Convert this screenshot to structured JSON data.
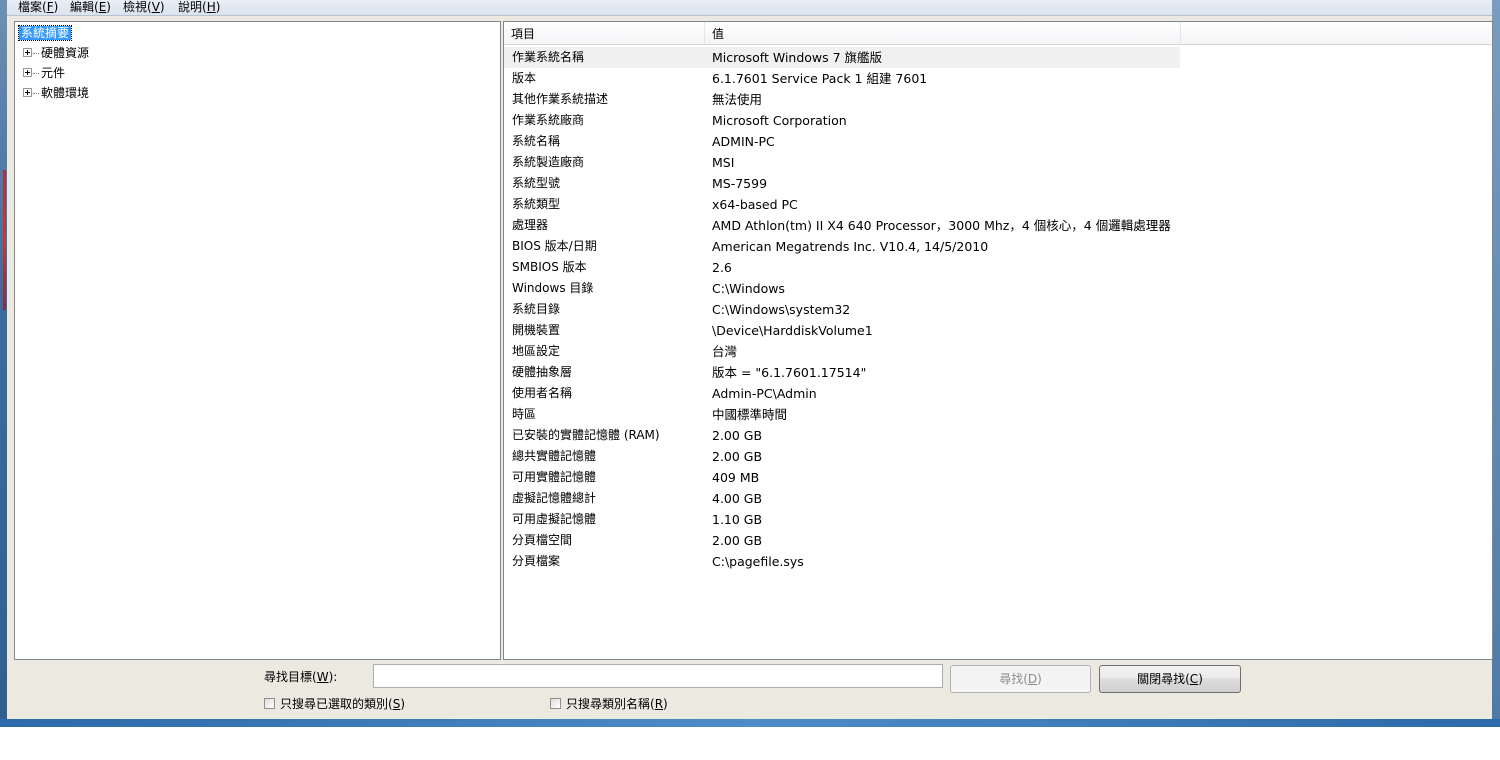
{
  "menu": [
    {
      "label": "檔案(",
      "key": "F",
      "end": ")"
    },
    {
      "label": "編輯(",
      "key": "E",
      "end": ")"
    },
    {
      "label": "檢視(",
      "key": "V",
      "end": ")"
    },
    {
      "label": "說明(",
      "key": "H",
      "end": ")"
    }
  ],
  "tree": {
    "root": "系統摘要",
    "children": [
      "硬體資源",
      "元件",
      "軟體環境"
    ]
  },
  "table": {
    "columns": [
      "項目",
      "值"
    ],
    "rows": [
      {
        "item": "作業系統名稱",
        "value": "Microsoft Windows 7 旗艦版"
      },
      {
        "item": "版本",
        "value": "6.1.7601 Service Pack 1 組建 7601"
      },
      {
        "item": "其他作業系統描述",
        "value": "無法使用"
      },
      {
        "item": "作業系統廠商",
        "value": "Microsoft Corporation"
      },
      {
        "item": "系統名稱",
        "value": "ADMIN-PC"
      },
      {
        "item": "系統製造廠商",
        "value": "MSI"
      },
      {
        "item": "系統型號",
        "value": "MS-7599"
      },
      {
        "item": "系統類型",
        "value": "x64-based PC"
      },
      {
        "item": "處理器",
        "value": "AMD Athlon(tm) II X4 640 Processor，3000 Mhz，4 個核心，4 個邏輯處理器"
      },
      {
        "item": "BIOS 版本/日期",
        "value": "American Megatrends Inc. V10.4, 14/5/2010"
      },
      {
        "item": "SMBIOS 版本",
        "value": "2.6"
      },
      {
        "item": "Windows 目錄",
        "value": "C:\\Windows"
      },
      {
        "item": "系統目錄",
        "value": "C:\\Windows\\system32"
      },
      {
        "item": "開機裝置",
        "value": "\\Device\\HarddiskVolume1"
      },
      {
        "item": "地區設定",
        "value": "台灣"
      },
      {
        "item": "硬體抽象層",
        "value": "版本 = \"6.1.7601.17514\""
      },
      {
        "item": "使用者名稱",
        "value": "Admin-PC\\Admin"
      },
      {
        "item": "時區",
        "value": "中國標準時間"
      },
      {
        "item": "已安裝的實體記憶體 (RAM)",
        "value": "2.00 GB"
      },
      {
        "item": "總共實體記憶體",
        "value": "2.00 GB"
      },
      {
        "item": "可用實體記憶體",
        "value": "409 MB"
      },
      {
        "item": "虛擬記憶體總計",
        "value": "4.00 GB"
      },
      {
        "item": "可用虛擬記憶體",
        "value": "1.10 GB"
      },
      {
        "item": "分頁檔空間",
        "value": "2.00 GB"
      },
      {
        "item": "分頁檔案",
        "value": "C:\\pagefile.sys"
      }
    ]
  },
  "find": {
    "label": "尋找目標(",
    "label_key": "W",
    "label_end": "):",
    "input_value": "",
    "find_button": "尋找(",
    "find_key": "D",
    "close_button": "關閉尋找(",
    "close_key": "C",
    "btn_end": ")",
    "check_selected": "只搜尋已選取的類別(",
    "check_selected_key": "S",
    "check_names": "只搜尋類別名稱(",
    "check_names_key": "R",
    "check_end": ")"
  }
}
